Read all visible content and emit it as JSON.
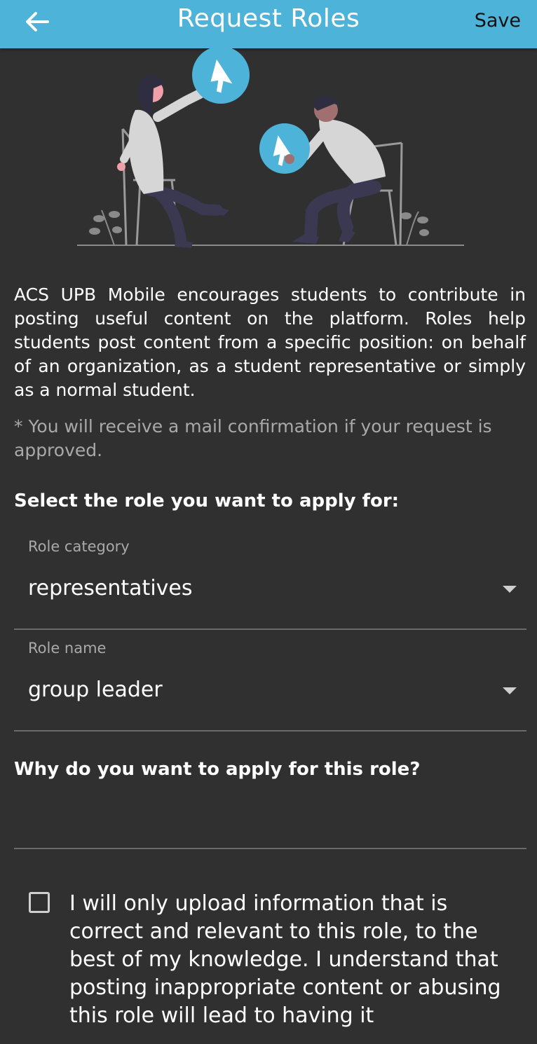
{
  "appbar": {
    "title": "Request Roles",
    "save_label": "Save",
    "back_icon": "arrow-left-icon",
    "color": "#4db3d8"
  },
  "intro": {
    "text": "ACS UPB Mobile encourages students to contribute in posting useful content on the platform. Roles help students post content from a specific position: on behalf of an organization, as a student representative or simply as a normal student.",
    "note": "* You will receive a mail confirmation if your request is approved."
  },
  "form": {
    "select_title": "Select the role you want to apply for:",
    "role_category": {
      "label": "Role category",
      "value": "representatives"
    },
    "role_name": {
      "label": "Role name",
      "value": "group leader"
    },
    "reason_title": "Why do you want to apply for this role?",
    "reason_value": "",
    "agreement": "I will only upload information that is correct and relevant to this role, to the best of my knowledge. I understand that posting inappropriate content or abusing this role will lead to having it"
  },
  "colors": {
    "background": "#303030",
    "accent": "#4db3d8",
    "muted_text": "#a9a9a9"
  }
}
